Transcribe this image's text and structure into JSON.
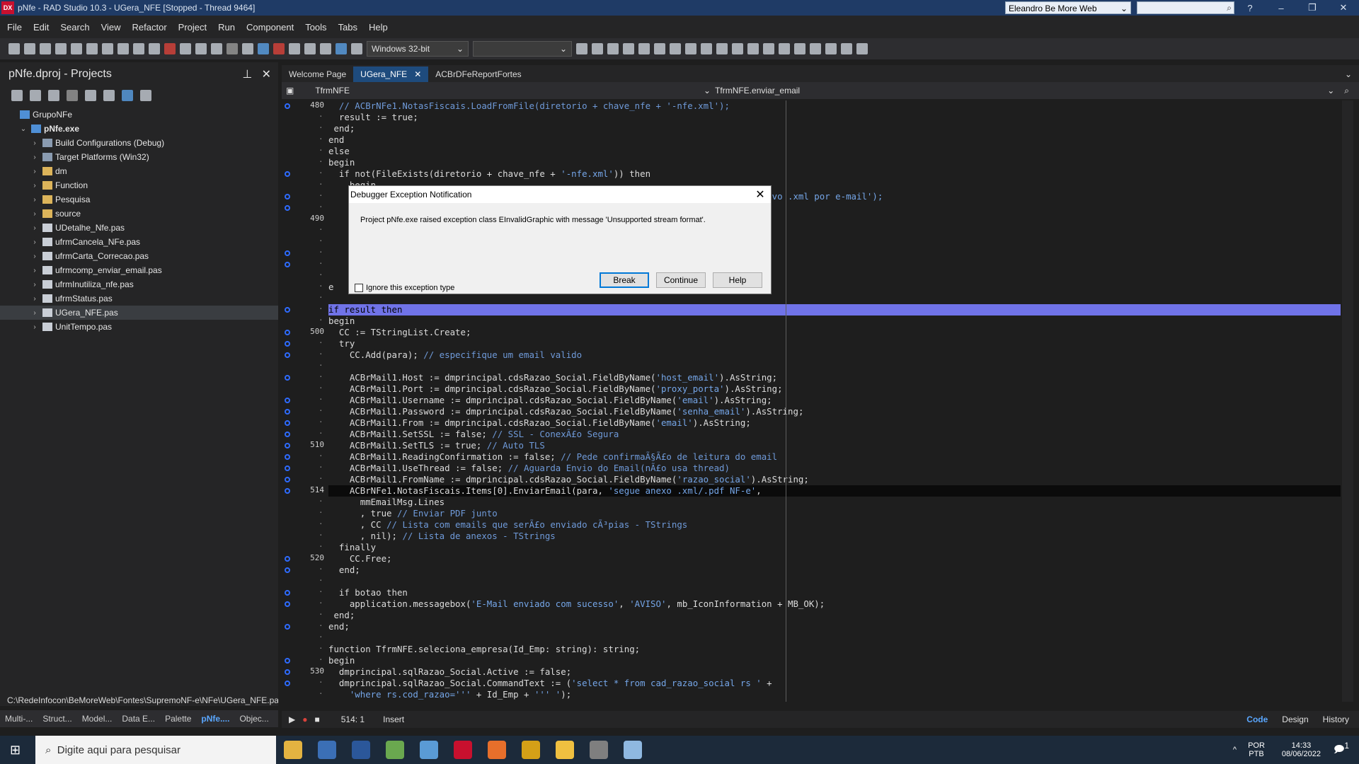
{
  "window": {
    "title": "pNfe - RAD Studio 10.3 - UGera_NFE [Stopped - Thread 9464]",
    "desktop": "Eleandro Be More Web",
    "logo": "DX"
  },
  "menu": [
    "File",
    "Edit",
    "Search",
    "View",
    "Refactor",
    "Project",
    "Run",
    "Component",
    "Tools",
    "Tabs",
    "Help"
  ],
  "toolbar": {
    "platform": "Windows 32-bit",
    "config": ""
  },
  "projects": {
    "title": "pNfe.dproj - Projects",
    "tree": [
      {
        "label": "GrupoNFe",
        "indent": 0,
        "icon": "grp",
        "chev": ""
      },
      {
        "label": "pNfe.exe",
        "indent": 1,
        "icon": "grp",
        "chev": "v",
        "bold": true
      },
      {
        "label": "Build Configurations (Debug)",
        "indent": 2,
        "icon": "cfg",
        "chev": ">"
      },
      {
        "label": "Target Platforms (Win32)",
        "indent": 2,
        "icon": "cfg",
        "chev": ">"
      },
      {
        "label": "dm",
        "indent": 2,
        "icon": "fold",
        "chev": ">"
      },
      {
        "label": "Function",
        "indent": 2,
        "icon": "fold",
        "chev": ">"
      },
      {
        "label": "Pesquisa",
        "indent": 2,
        "icon": "fold",
        "chev": ">"
      },
      {
        "label": "source",
        "indent": 2,
        "icon": "fold",
        "chev": ">"
      },
      {
        "label": "UDetalhe_Nfe.pas",
        "indent": 2,
        "icon": "file",
        "chev": ">"
      },
      {
        "label": "ufrmCancela_NFe.pas",
        "indent": 2,
        "icon": "file",
        "chev": ">"
      },
      {
        "label": "ufrmCarta_Correcao.pas",
        "indent": 2,
        "icon": "file",
        "chev": ">"
      },
      {
        "label": "ufrmcomp_enviar_email.pas",
        "indent": 2,
        "icon": "file",
        "chev": ">"
      },
      {
        "label": "ufrmInutiliza_nfe.pas",
        "indent": 2,
        "icon": "file",
        "chev": ">"
      },
      {
        "label": "ufrmStatus.pas",
        "indent": 2,
        "icon": "file",
        "chev": ">"
      },
      {
        "label": "UGera_NFE.pas",
        "indent": 2,
        "icon": "file",
        "chev": ">",
        "sel": true
      },
      {
        "label": "UnitTempo.pas",
        "indent": 2,
        "icon": "file",
        "chev": ">"
      }
    ],
    "path": "C:\\RedeInfocon\\BeMoreWeb\\Fontes\\SupremoNF-e\\NFe\\UGera_NFE.pas"
  },
  "bottom_tabs": [
    "Multi-...",
    "Struct...",
    "Model...",
    "Data E...",
    "Palette",
    "pNfe....",
    "Objec..."
  ],
  "editor": {
    "tabs": [
      "Welcome Page",
      "UGera_NFE",
      "ACBrDFeReportFortes"
    ],
    "unit": "TfrmNFE",
    "method": "TfrmNFE.enviar_email",
    "gutter": [
      {
        "n": "480",
        "bp": true
      },
      {
        "n": "",
        "bp": false
      },
      {
        "n": "",
        "bp": false
      },
      {
        "n": "",
        "bp": false
      },
      {
        "n": "",
        "bp": false
      },
      {
        "n": "",
        "bp": false
      },
      {
        "n": "",
        "bp": true
      },
      {
        "n": "",
        "bp": false
      },
      {
        "n": "",
        "bp": true
      },
      {
        "n": "",
        "bp": true
      },
      {
        "n": "490",
        "bp": false
      },
      {
        "n": "",
        "bp": false
      },
      {
        "n": "",
        "bp": false
      },
      {
        "n": "",
        "bp": true
      },
      {
        "n": "",
        "bp": true
      },
      {
        "n": "",
        "bp": false
      },
      {
        "n": "",
        "bp": false
      },
      {
        "n": "",
        "bp": false
      },
      {
        "n": "",
        "bp": true
      },
      {
        "n": "",
        "bp": false
      },
      {
        "n": "500",
        "bp": true
      },
      {
        "n": "",
        "bp": true
      },
      {
        "n": "",
        "bp": true
      },
      {
        "n": "",
        "bp": false
      },
      {
        "n": "",
        "bp": true
      },
      {
        "n": "",
        "bp": false
      },
      {
        "n": "",
        "bp": true
      },
      {
        "n": "",
        "bp": true
      },
      {
        "n": "",
        "bp": true
      },
      {
        "n": "",
        "bp": true
      },
      {
        "n": "510",
        "bp": true
      },
      {
        "n": "",
        "bp": true
      },
      {
        "n": "",
        "bp": true
      },
      {
        "n": "",
        "bp": true
      },
      {
        "n": "514",
        "bp": true
      },
      {
        "n": "",
        "bp": false
      },
      {
        "n": "",
        "bp": false
      },
      {
        "n": "",
        "bp": false
      },
      {
        "n": "",
        "bp": false
      },
      {
        "n": "",
        "bp": false
      },
      {
        "n": "520",
        "bp": true
      },
      {
        "n": "",
        "bp": true
      },
      {
        "n": "",
        "bp": false
      },
      {
        "n": "",
        "bp": true
      },
      {
        "n": "",
        "bp": true
      },
      {
        "n": "",
        "bp": false
      },
      {
        "n": "",
        "bp": true
      },
      {
        "n": "",
        "bp": false
      },
      {
        "n": "",
        "bp": false
      },
      {
        "n": "",
        "bp": true
      },
      {
        "n": "530",
        "bp": true
      },
      {
        "n": "",
        "bp": true
      },
      {
        "n": "",
        "bp": false
      }
    ],
    "lines": [
      [
        [
          "  // ACBrNFe1.NotasFiscais.LoadFromFile(diretorio + chave_nfe + '-nfe.xml');",
          "cmt"
        ]
      ],
      [
        [
          "  result := true;",
          ""
        ]
      ],
      [
        [
          " end;",
          ""
        ]
      ],
      [
        [
          "end",
          ""
        ]
      ],
      [
        [
          "else",
          ""
        ]
      ],
      [
        [
          "begin",
          ""
        ]
      ],
      [
        [
          "  if not(FileExists(diretorio + chave_nfe + ",
          ""
        ],
        [
          "'-nfe.xml'",
          "str"
        ],
        [
          ")) then",
          ""
        ]
      ],
      [
        [
          "    begin",
          ""
        ]
      ],
      [
        [
          "      ",
          ""
        ],
        [
          "                                                               enviado o arquivo .xml por e-mail');",
          "str"
        ]
      ],
      [
        [
          "",
          ""
        ]
      ],
      [
        [
          "",
          ""
        ]
      ],
      [
        [
          "",
          ""
        ]
      ],
      [
        [
          "",
          ""
        ]
      ],
      [
        [
          "",
          ""
        ]
      ],
      [
        [
          "",
          ""
        ]
      ],
      [
        [
          "",
          ""
        ]
      ],
      [
        [
          "e",
          ""
        ]
      ],
      [
        [
          "",
          ""
        ]
      ],
      [
        [
          "if result then",
          "exec"
        ]
      ],
      [
        [
          "begin",
          ""
        ]
      ],
      [
        [
          "  CC := TStringList.Create;",
          ""
        ]
      ],
      [
        [
          "  try",
          ""
        ]
      ],
      [
        [
          "    CC.Add(para); ",
          ""
        ],
        [
          "// especifique um email valido",
          "cmt"
        ]
      ],
      [
        [
          "",
          ""
        ]
      ],
      [
        [
          "    ACBrMail1.Host := dmprincipal.cdsRazao_Social.FieldByName(",
          ""
        ],
        [
          "'host_email'",
          "str"
        ],
        [
          ").AsString;",
          ""
        ]
      ],
      [
        [
          "    ACBrMail1.Port := dmprincipal.cdsRazao_Social.FieldByName(",
          ""
        ],
        [
          "'proxy_porta'",
          "str"
        ],
        [
          ").AsString;",
          ""
        ]
      ],
      [
        [
          "    ACBrMail1.Username := dmprincipal.cdsRazao_Social.FieldByName(",
          ""
        ],
        [
          "'email'",
          "str"
        ],
        [
          ").AsString;",
          ""
        ]
      ],
      [
        [
          "    ACBrMail1.Password := dmprincipal.cdsRazao_Social.FieldByName(",
          ""
        ],
        [
          "'senha_email'",
          "str"
        ],
        [
          ").AsString;",
          ""
        ]
      ],
      [
        [
          "    ACBrMail1.From := dmprincipal.cdsRazao_Social.FieldByName(",
          ""
        ],
        [
          "'email'",
          "str"
        ],
        [
          ").AsString;",
          ""
        ]
      ],
      [
        [
          "    ACBrMail1.SetSSL := false; ",
          ""
        ],
        [
          "// SSL - ConexÃ£o Segura",
          "cmt"
        ]
      ],
      [
        [
          "    ACBrMail1.SetTLS := true; ",
          ""
        ],
        [
          "// Auto TLS",
          "cmt"
        ]
      ],
      [
        [
          "    ACBrMail1.ReadingConfirmation := false; ",
          ""
        ],
        [
          "// Pede confirmaÃ§Ã£o de leitura do email",
          "cmt"
        ]
      ],
      [
        [
          "    ACBrMail1.UseThread := false; ",
          ""
        ],
        [
          "// Aguarda Envio do Email(nÃ£o usa thread)",
          "cmt"
        ]
      ],
      [
        [
          "    ACBrMail1.FromName := dmprincipal.cdsRazao_Social.FieldByName(",
          ""
        ],
        [
          "'razao_social'",
          "str"
        ],
        [
          ").AsString;",
          ""
        ]
      ],
      [
        [
          "    ACBrNFe1.NotasFiscais.Items[0].EnviarEmail(para, ",
          "cur"
        ],
        [
          "'segue anexo .xml/.pdf NF-e'",
          "str"
        ],
        [
          ",",
          ""
        ]
      ],
      [
        [
          "      mmEmailMsg.Lines",
          ""
        ]
      ],
      [
        [
          "      , true ",
          ""
        ],
        [
          "// Enviar PDF junto",
          "cmt"
        ]
      ],
      [
        [
          "      , CC ",
          ""
        ],
        [
          "// Lista com emails que serÃ£o enviado cÃ³pias - TStrings",
          "cmt"
        ]
      ],
      [
        [
          "      , nil); ",
          ""
        ],
        [
          "// Lista de anexos - TStrings",
          "cmt"
        ]
      ],
      [
        [
          "  finally",
          ""
        ]
      ],
      [
        [
          "    CC.Free;",
          ""
        ]
      ],
      [
        [
          "  end;",
          ""
        ]
      ],
      [
        [
          "",
          ""
        ]
      ],
      [
        [
          "  if botao then",
          ""
        ]
      ],
      [
        [
          "    application.messagebox(",
          ""
        ],
        [
          "'E-Mail enviado com sucesso'",
          "str"
        ],
        [
          ", ",
          ""
        ],
        [
          "'AVISO'",
          "str"
        ],
        [
          ", mb_IconInformation + MB_OK);",
          ""
        ]
      ],
      [
        [
          " end;",
          ""
        ]
      ],
      [
        [
          "end;",
          ""
        ]
      ],
      [
        [
          "",
          ""
        ]
      ],
      [
        [
          "function TfrmNFE.seleciona_empresa(Id_Emp: string): string;",
          ""
        ]
      ],
      [
        [
          "begin",
          ""
        ]
      ],
      [
        [
          "  dmprincipal.sqlRazao_Social.Active := false;",
          ""
        ]
      ],
      [
        [
          "  dmprincipal.sqlRazao_Social.CommandText := (",
          ""
        ],
        [
          "'select * from cad_razao_social rs '",
          "str"
        ],
        [
          " +",
          ""
        ]
      ],
      [
        [
          "    ",
          ""
        ],
        [
          "'where rs.cod_razao='''",
          "str"
        ],
        [
          " + Id_Emp + ",
          ""
        ],
        [
          "''' '",
          "str"
        ],
        [
          ");",
          ""
        ]
      ]
    ]
  },
  "dialog": {
    "title": "Debugger Exception Notification",
    "message": "Project pNfe.exe raised exception class EInvalidGraphic with message 'Unsupported stream format'.",
    "ignore": "Ignore this exception type",
    "break": "Break",
    "continue": "Continue",
    "help": "Help"
  },
  "status": {
    "pos": "514:  1",
    "mode": "Insert",
    "views": [
      "Code",
      "Design",
      "History"
    ]
  },
  "taskbar": {
    "search": "Digite aqui para pesquisar",
    "lang1": "POR",
    "lang2": "PTB",
    "time": "14:33",
    "date": "08/06/2022",
    "notif": "1"
  }
}
